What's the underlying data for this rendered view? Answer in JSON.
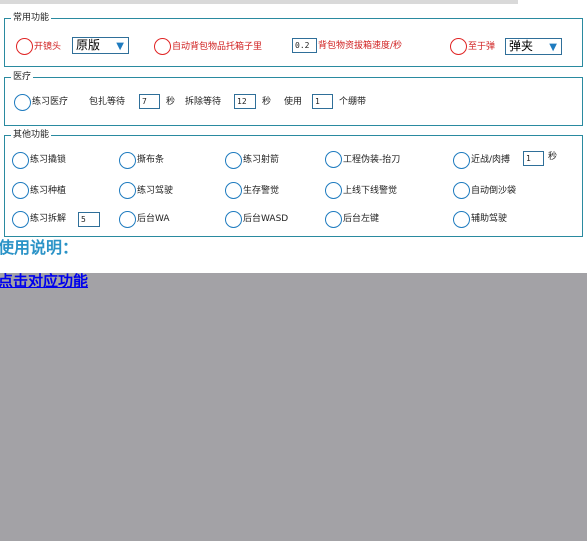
{
  "common": {
    "legend": "常用功能",
    "open_mirror_label": "开镜头",
    "mirror_select_value": "原版",
    "auto_backpack_label": "自动背包物品托箱子里",
    "backpack_speed_value": "0.2",
    "backpack_speed_label": "背包物资拔箱速度/秒",
    "zhizi_label": "至于弹",
    "zhizi_select_value": "弹夹"
  },
  "medical": {
    "legend": "医疗",
    "practice_label": "练习医疗",
    "bandage_wait_label": "包扎等待",
    "bandage_wait_value": "7",
    "sec1": "秒",
    "disarm_wait_label": "拆除等待",
    "disarm_wait_value": "12",
    "sec2": "秒",
    "use_label": "使用",
    "use_value": "1",
    "bundle_label": "个绷带"
  },
  "other": {
    "legend": "其他功能",
    "items": [
      {
        "label": "练习撬锁"
      },
      {
        "label": "撕布条"
      },
      {
        "label": "练习射箭"
      },
      {
        "label": "工程伪装-抬刀"
      },
      {
        "label": "近战/肉搏"
      },
      {
        "label": "练习种植"
      },
      {
        "label": "练习驾驶"
      },
      {
        "label": "生存警觉"
      },
      {
        "label": "上线下线警觉"
      },
      {
        "label": "自动倒沙袋"
      },
      {
        "label": "练习拆解"
      },
      {
        "label": "后台WA"
      },
      {
        "label": "后台WASD"
      },
      {
        "label": "后台左键"
      },
      {
        "label": "辅助驾驶"
      }
    ],
    "melee_value": "1",
    "melee_unit": "秒",
    "dismantle_value": "5"
  },
  "instructions": {
    "heading": "使用说明：",
    "link": "点击对应功能"
  }
}
